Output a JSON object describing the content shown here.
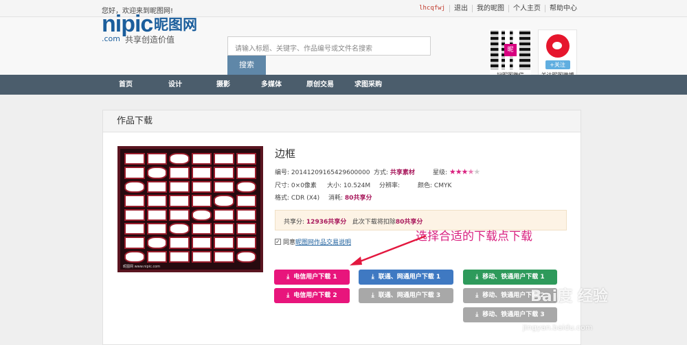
{
  "topbar": {
    "welcome": "您好，欢迎来到昵图网!",
    "links": [
      "lhcqfwj",
      "退出",
      "我的昵图",
      "个人主页",
      "帮助中心"
    ]
  },
  "logo": {
    "nipic": "nipic",
    "cn": "昵图网",
    "com": ".com",
    "slogan": "共享创造价值"
  },
  "search": {
    "placeholder": "请输入标题、关键字、作品编号或文件名搜索",
    "button": "搜索"
  },
  "qr": {
    "center": "昵",
    "label": "扫昵图微信"
  },
  "weibo": {
    "follow": "+关注",
    "label": "关注昵图微博"
  },
  "nav": [
    "首页",
    "设计",
    "摄影",
    "多媒体",
    "原创交易",
    "求图采购"
  ],
  "card": {
    "header": "作品下载",
    "thumb_caption": "昵图网 www.nipic.com",
    "title": "边框",
    "meta": {
      "id_label": "编号:",
      "id": "20141209165429600000",
      "mode_label": "方式:",
      "mode": "共享素材",
      "level_label": "星级:",
      "stars": {
        "filled": 3.5,
        "total": 5
      },
      "size_label": "尺寸:",
      "size": "0×0像素",
      "filesize_label": "大小:",
      "filesize": "10.524M",
      "res_label": "分辨率:",
      "color_label": "颜色:",
      "color": "CMYK",
      "format_label": "格式:",
      "format": "CDR (X4)",
      "cost_label": "消耗:",
      "cost": "80共享分"
    },
    "share": {
      "label": "共享分:",
      "value": "12936共享分",
      "deduct_prefix": "此次下载将扣除",
      "deduct": "80共享分"
    },
    "agree": {
      "check": "✓",
      "prefix": "同意",
      "link": "昵图网作品交易说明"
    },
    "hint": "选择合适的下载点下载",
    "buttons": {
      "telecom1": "电信用户下载 1",
      "telecom2": "电信用户下载 2",
      "unicom1": "联通、网通用户下载 1",
      "unicom3": "联通、网通用户下载 3",
      "mobile1": "移动、铁通用户下载 1",
      "mobile2": "移动、铁通用户下载 2",
      "mobile3": "移动、铁通用户下载 3"
    },
    "download_icon": "⤓"
  },
  "watermark": {
    "brand": "Bai度 经验",
    "url": "jingyan.baidu.com"
  },
  "colors": {
    "accent": "#e8157c",
    "nav": "#4b5d6c",
    "blue": "#3f79c2",
    "green": "#2e9a5b",
    "gray": "#a8a8a8"
  }
}
